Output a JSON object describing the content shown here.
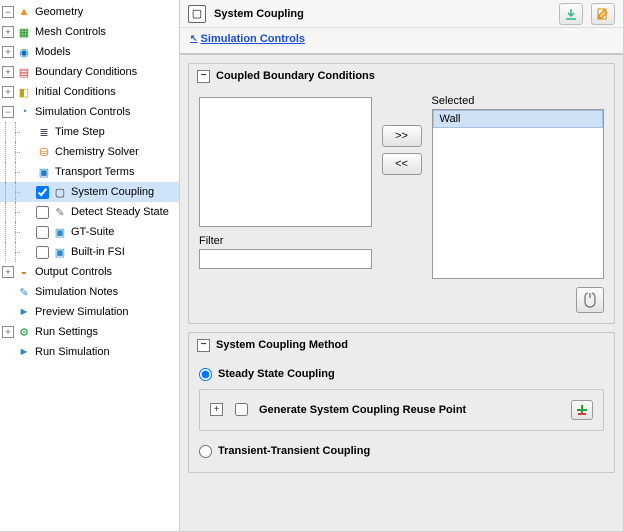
{
  "tree": {
    "items": [
      {
        "label": "Geometry",
        "icon": "geometry-icon",
        "level": 0,
        "expander": "-",
        "checkbox": false,
        "checked": false,
        "selected": false,
        "iconClass": "i-geometry",
        "glyph": "▲"
      },
      {
        "label": "Mesh Controls",
        "icon": "mesh-controls-icon",
        "level": 0,
        "expander": "+",
        "checkbox": false,
        "checked": false,
        "selected": false,
        "iconClass": "i-mesh",
        "glyph": "▦"
      },
      {
        "label": "Models",
        "icon": "models-icon",
        "level": 0,
        "expander": "+",
        "checkbox": false,
        "checked": false,
        "selected": false,
        "iconClass": "i-models",
        "glyph": "◉"
      },
      {
        "label": "Boundary Conditions",
        "icon": "boundary-conditions-icon",
        "level": 0,
        "expander": "+",
        "checkbox": false,
        "checked": false,
        "selected": false,
        "iconClass": "i-bc",
        "glyph": "▤"
      },
      {
        "label": "Initial Conditions",
        "icon": "initial-conditions-icon",
        "level": 0,
        "expander": "+",
        "checkbox": false,
        "checked": false,
        "selected": false,
        "iconClass": "i-ic",
        "glyph": "◧"
      },
      {
        "label": "Simulation Controls",
        "icon": "simulation-controls-icon",
        "level": 0,
        "expander": "-",
        "checkbox": false,
        "checked": false,
        "selected": false,
        "iconClass": "i-sim",
        "glyph": "◔"
      },
      {
        "label": "Time Step",
        "icon": "time-step-icon",
        "level": 1,
        "expander": "",
        "checkbox": false,
        "checked": false,
        "selected": false,
        "iconClass": "i-ts",
        "glyph": "≣"
      },
      {
        "label": "Chemistry Solver",
        "icon": "chemistry-solver-icon",
        "level": 1,
        "expander": "",
        "checkbox": false,
        "checked": false,
        "selected": false,
        "iconClass": "i-chem",
        "glyph": "⛁"
      },
      {
        "label": "Transport Terms",
        "icon": "transport-terms-icon",
        "level": 1,
        "expander": "",
        "checkbox": false,
        "checked": false,
        "selected": false,
        "iconClass": "i-tt",
        "glyph": "▣"
      },
      {
        "label": "System Coupling",
        "icon": "system-coupling-icon",
        "level": 1,
        "expander": "",
        "checkbox": true,
        "checked": true,
        "selected": true,
        "iconClass": "i-sc",
        "glyph": "▢"
      },
      {
        "label": "Detect Steady State",
        "icon": "detect-steady-state-icon",
        "level": 1,
        "expander": "",
        "checkbox": true,
        "checked": false,
        "selected": false,
        "iconClass": "i-dss",
        "glyph": "✎"
      },
      {
        "label": "GT-Suite",
        "icon": "gt-suite-icon",
        "level": 1,
        "expander": "",
        "checkbox": true,
        "checked": false,
        "selected": false,
        "iconClass": "i-gt",
        "glyph": "▣"
      },
      {
        "label": "Built-in FSI",
        "icon": "built-in-fsi-icon",
        "level": 1,
        "expander": "",
        "checkbox": true,
        "checked": false,
        "selected": false,
        "iconClass": "i-fsi",
        "glyph": "▣"
      },
      {
        "label": "Output Controls",
        "icon": "output-controls-icon",
        "level": 0,
        "expander": "+",
        "checkbox": false,
        "checked": false,
        "selected": false,
        "iconClass": "i-out",
        "glyph": "◒"
      },
      {
        "label": "Simulation Notes",
        "icon": "simulation-notes-icon",
        "level": 0,
        "expander": "",
        "checkbox": false,
        "checked": false,
        "selected": false,
        "iconClass": "i-notes",
        "glyph": "✎"
      },
      {
        "label": "Preview Simulation",
        "icon": "preview-simulation-icon",
        "level": 0,
        "expander": "",
        "checkbox": false,
        "checked": false,
        "selected": false,
        "iconClass": "i-prev",
        "glyph": "►"
      },
      {
        "label": "Run Settings",
        "icon": "run-settings-icon",
        "level": 0,
        "expander": "+",
        "checkbox": false,
        "checked": false,
        "selected": false,
        "iconClass": "i-runset",
        "glyph": "⚙"
      },
      {
        "label": "Run Simulation",
        "icon": "run-simulation-icon",
        "level": 0,
        "expander": "",
        "checkbox": false,
        "checked": false,
        "selected": false,
        "iconClass": "i-run",
        "glyph": "►"
      }
    ]
  },
  "header": {
    "title": "System Coupling",
    "breadcrumb": "Simulation Controls",
    "breadcrumb_prefix": "↖"
  },
  "groups": {
    "cbc": {
      "title": "Coupled Boundary Conditions",
      "available_label": "",
      "selected_label": "Selected",
      "available": [],
      "selected": [
        "Wall"
      ],
      "add_label": ">>",
      "remove_label": "<<",
      "filter_label": "Filter",
      "filter_value": ""
    },
    "method": {
      "title": "System Coupling Method",
      "options": {
        "steady": "Steady State Coupling",
        "transient": "Transient-Transient Coupling"
      },
      "selected": "steady",
      "reuse_label": "Generate System Coupling Reuse Point",
      "reuse_checked": false
    }
  }
}
